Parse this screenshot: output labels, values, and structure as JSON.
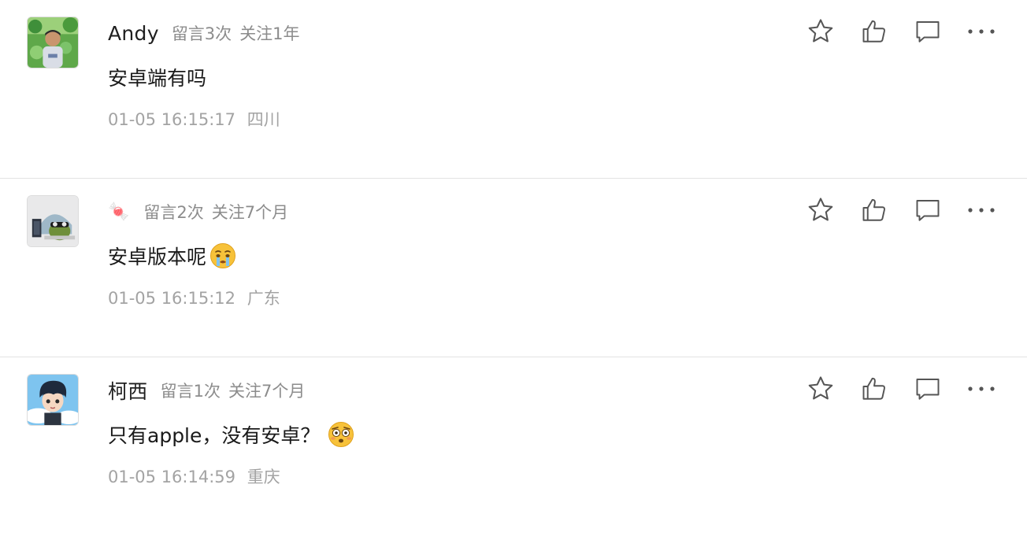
{
  "comments": [
    {
      "user": "Andy",
      "user_emoji": "",
      "message_count": "留言3次",
      "follow_duration": "关注1年",
      "content": "安卓端有吗",
      "content_emoji": "",
      "date": "01-05 16:15:17",
      "location": "四川"
    },
    {
      "user": "",
      "user_emoji": "🍬",
      "message_count": "留言2次",
      "follow_duration": "关注7个月",
      "content": "安卓版本呢",
      "content_emoji": "crying-face",
      "date": "01-05 16:15:12",
      "location": "广东"
    },
    {
      "user": "柯西",
      "user_emoji": "",
      "message_count": "留言1次",
      "follow_duration": "关注7个月",
      "content": "只有apple，没有安卓？",
      "content_emoji": "flushed-face",
      "date": "01-05 16:14:59",
      "location": "重庆"
    }
  ],
  "action_icons": [
    "star-icon",
    "thumbs-up-icon",
    "comment-icon",
    "more-icon"
  ],
  "colors": {
    "meta_text": "#8c8c8c",
    "footer_text": "#a3a3a3",
    "icon_stroke": "#555555",
    "divider": "#e3e3e3"
  }
}
